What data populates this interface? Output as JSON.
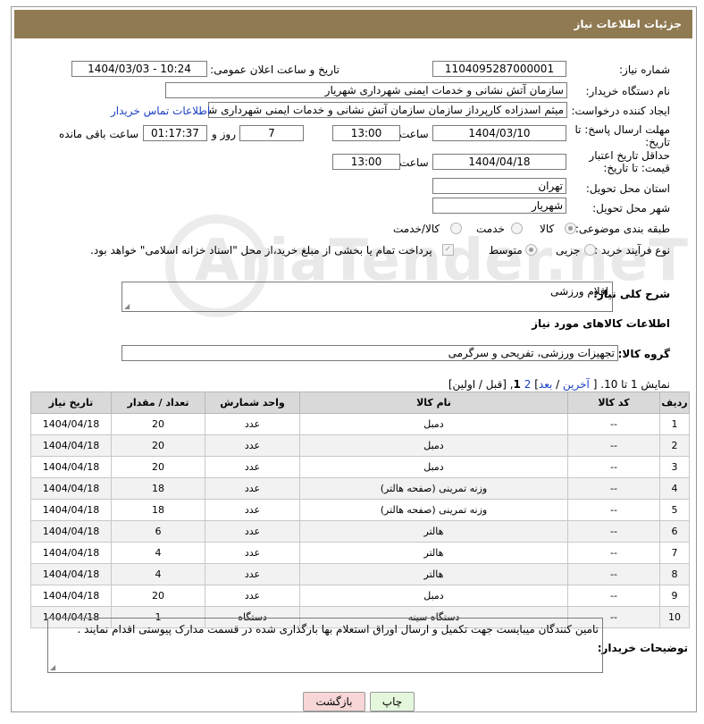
{
  "header": {
    "title": "جزئیات اطلاعات نیاز"
  },
  "watermark": "AriaTender.neT",
  "fields": {
    "need_number_label": "شماره نیاز:",
    "need_number": "1104095287000001",
    "announce_label": "تاریخ و ساعت اعلان عمومی:",
    "announce_value": "1404/03/03 - 10:24",
    "buyer_label": "نام دستگاه خریدار:",
    "buyer_value": "سازمان آتش نشانی و خدمات ایمنی شهرداری شهریار",
    "creator_label": "ایجاد کننده درخواست:",
    "creator_value": "میثم اسدزاده کارپرداز سازمان سازمان آتش نشانی و خدمات ایمنی شهرداری شهریار",
    "contact_link": "اطلاعات تماس خریدار",
    "deadline_label": "مهلت ارسال پاسخ: تا تاریخ:",
    "deadline_date": "1404/03/10",
    "time_label": "ساعت",
    "deadline_time": "13:00",
    "days_value": "7",
    "days_label": "روز و",
    "remaining_time": "01:17:37",
    "remaining_label": "ساعت باقی مانده",
    "price_label": "حداقل تاریخ اعتبار قیمت: تا تاریخ:",
    "price_date": "1404/04/18",
    "price_time": "13:00",
    "province_label": "استان محل تحویل:",
    "province_value": "تهران",
    "city_label": "شهر محل تحویل:",
    "city_value": "شهریار",
    "category_label": "طبقه بندی موضوعی:",
    "category_options": [
      "کالا",
      "خدمت",
      "کالا/خدمت"
    ],
    "process_label": "نوع فرآیند خرید :",
    "process_options": [
      "جزیی",
      "متوسط"
    ],
    "payment_text": "پرداخت تمام یا بخشی از مبلغ خرید،از محل \"اسناد خزانه اسلامی\" خواهد بود."
  },
  "description": {
    "label": "شرح کلی نیاز:",
    "value": "اقلام ورزشی"
  },
  "goods_section": {
    "title": "اطلاعات کالاهای مورد نیاز",
    "group_label": "گروه کالا:",
    "group_value": "تجهیزات ورزشی، تفریحی و سرگرمی"
  },
  "pagination": {
    "show_text": "نمایش 1 تا 10.",
    "open": "[",
    "last": "آخرین",
    "sep1": "/",
    "next": "بعد",
    "close": "]",
    "p2": "2",
    "comma": ",",
    "p1": "1",
    "prev_first": "[قبل / اولین]"
  },
  "table": {
    "headers": [
      "ردیف",
      "کد کالا",
      "نام کالا",
      "واحد شمارش",
      "تعداد / مقدار",
      "تاریخ نیاز"
    ],
    "rows": [
      [
        "1",
        "--",
        "دمبل",
        "عدد",
        "20",
        "1404/04/18"
      ],
      [
        "2",
        "--",
        "دمبل",
        "عدد",
        "20",
        "1404/04/18"
      ],
      [
        "3",
        "--",
        "دمبل",
        "عدد",
        "20",
        "1404/04/18"
      ],
      [
        "4",
        "--",
        "وزنه تمرینی (صفحه هالتر)",
        "عدد",
        "18",
        "1404/04/18"
      ],
      [
        "5",
        "--",
        "وزنه تمرینی (صفحه هالتر)",
        "عدد",
        "18",
        "1404/04/18"
      ],
      [
        "6",
        "--",
        "هالتر",
        "عدد",
        "6",
        "1404/04/18"
      ],
      [
        "7",
        "--",
        "هالتر",
        "عدد",
        "4",
        "1404/04/18"
      ],
      [
        "8",
        "--",
        "هالتر",
        "عدد",
        "4",
        "1404/04/18"
      ],
      [
        "9",
        "--",
        "دمبل",
        "عدد",
        "20",
        "1404/04/18"
      ],
      [
        "10",
        "--",
        "دستگاه سینه",
        "دستگاه",
        "1",
        "1404/04/18"
      ]
    ]
  },
  "notes": {
    "label": "توضیحات خریدار:",
    "value": "تامین کنندگان میبایست جهت تکمیل و ارسال اوراق استعلام بها بارگذاری شده در قسمت مدارک پیوستی اقدام نمایند ."
  },
  "buttons": {
    "print": "چاپ",
    "back": "بازگشت"
  },
  "colors": {
    "header_bg": "#8f7a52",
    "back_button_bg": "#f6d6d6",
    "print_button_bg": "#e4f7dc",
    "link": "#1a3fc4"
  }
}
